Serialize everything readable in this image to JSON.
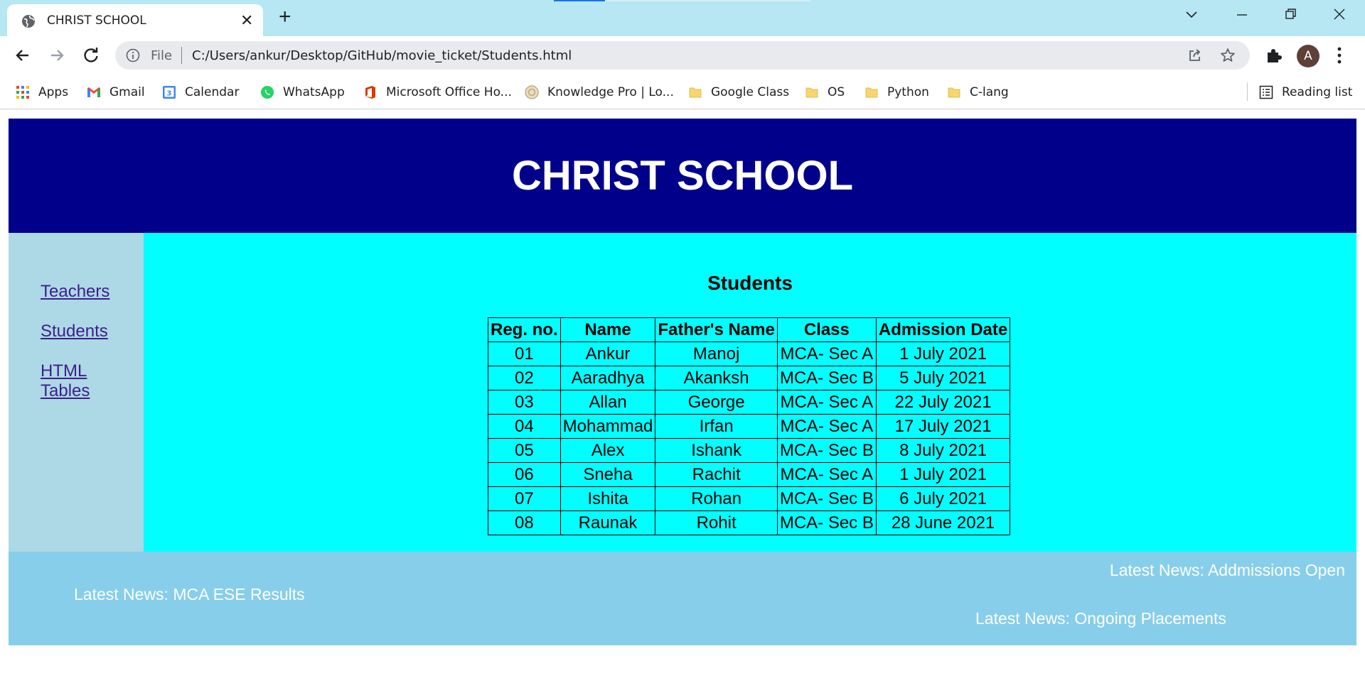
{
  "browser": {
    "tab_title": "CHRIST SCHOOL",
    "tab_close": "✕",
    "new_tab": "+",
    "window_controls": {
      "tab_search": "⌄",
      "minimize": "—",
      "restore": "❐",
      "close": "✕"
    },
    "omnibox": {
      "scheme_label": "File",
      "url": "C:/Users/ankur/Desktop/GitHub/movie_ticket/Students.html"
    },
    "avatar_initial": "A",
    "bookmarks": [
      {
        "label": "Apps",
        "icon": "apps-grid-icon"
      },
      {
        "label": "Gmail",
        "icon": "gmail-icon"
      },
      {
        "label": "Calendar",
        "icon": "calendar-icon"
      },
      {
        "label": "WhatsApp",
        "icon": "whatsapp-icon"
      },
      {
        "label": "Microsoft Office Ho...",
        "icon": "office-icon"
      },
      {
        "label": "Knowledge Pro | Lo...",
        "icon": "knowledge-pro-icon"
      },
      {
        "label": "Google Class",
        "icon": "folder-icon"
      },
      {
        "label": "OS",
        "icon": "folder-icon"
      },
      {
        "label": "Python",
        "icon": "folder-icon"
      },
      {
        "label": "C-lang",
        "icon": "folder-icon"
      }
    ],
    "reading_list": "Reading list"
  },
  "page": {
    "header_title": "CHRIST SCHOOL",
    "sidebar_links": [
      "Teachers",
      "Students",
      "HTML Tables"
    ],
    "section_title": "Students",
    "table": {
      "headers": [
        "Reg. no.",
        "Name",
        "Father's Name",
        "Class",
        "Admission Date"
      ],
      "rows": [
        [
          "01",
          "Ankur",
          "Manoj",
          "MCA- Sec A",
          "1 July 2021"
        ],
        [
          "02",
          "Aaradhya",
          "Akanksh",
          "MCA- Sec B",
          "5 July 2021"
        ],
        [
          "03",
          "Allan",
          "George",
          "MCA- Sec A",
          "22 July 2021"
        ],
        [
          "04",
          "Mohammad",
          "Irfan",
          "MCA- Sec A",
          "17 July 2021"
        ],
        [
          "05",
          "Alex",
          "Ishank",
          "MCA- Sec B",
          "8 July 2021"
        ],
        [
          "06",
          "Sneha",
          "Rachit",
          "MCA- Sec A",
          "1 July 2021"
        ],
        [
          "07",
          "Ishita",
          "Rohan",
          "MCA- Sec B",
          "6 July 2021"
        ],
        [
          "08",
          "Raunak",
          "Rohit",
          "MCA- Sec B",
          "28 June 2021"
        ]
      ]
    },
    "news": [
      "Latest News: Addmissions Open",
      "Latest News: MCA ESE Results",
      "Latest News: Ongoing Placements"
    ]
  },
  "colors": {
    "header_bg": "#00008b",
    "sidebar_bg": "#add8e6",
    "main_bg": "#00ffff",
    "footer_bg": "#87ceeb",
    "tabbar_bg": "#b6e7f2",
    "link_color": "#3c1f8b"
  }
}
